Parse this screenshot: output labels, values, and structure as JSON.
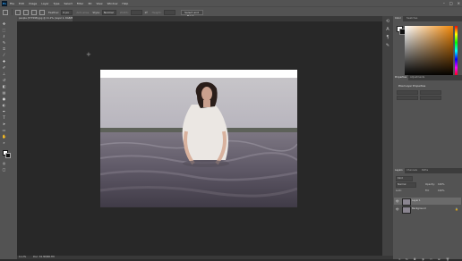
{
  "app": {
    "logo": "Ps"
  },
  "menu": [
    "File",
    "Edit",
    "Image",
    "Layer",
    "Type",
    "Select",
    "Filter",
    "3D",
    "View",
    "Window",
    "Help"
  ],
  "window_controls": [
    "–",
    "□",
    "×"
  ],
  "options": {
    "feather_label": "Feather:",
    "feather_value": "0 px",
    "anti_alias": "Anti-alias",
    "style_label": "Style:",
    "style_value": "Normal",
    "width_label": "Width:",
    "height_label": "Height:",
    "select_mask_button": "Select and Mask..."
  },
  "document": {
    "tab_title": "people (577098).jpg @ 11.2% (Layer 1, RGB/8#) *",
    "zoom": "11.2%",
    "size_info": "Doc: 34.3M/68.7M"
  },
  "panels": {
    "color_tabs": [
      "Color",
      "Swatches"
    ],
    "properties_tabs": [
      "Properties",
      "Adjustments"
    ],
    "properties_title": "Pixel Layer Properties",
    "layers_tabs": [
      "Layers",
      "Channels",
      "Paths"
    ],
    "kind_label": "Kind",
    "blend_mode": "Normal",
    "opacity_label": "Opacity:",
    "opacity_value": "100%",
    "lock_label": "Lock:",
    "fill_label": "Fill:",
    "fill_value": "100%"
  },
  "layers": [
    {
      "name": "Layer 1",
      "selected": true
    },
    {
      "name": "Background",
      "selected": false
    }
  ],
  "colors": {
    "foreground": "#ffffff",
    "background": "#111111",
    "selected_hue": "#f0880a"
  },
  "icons": {
    "tools": [
      "move-icon",
      "marquee-icon",
      "lasso-icon",
      "quick-select-icon",
      "crop-icon",
      "eyedropper-icon",
      "healing-icon",
      "brush-icon",
      "stamp-icon",
      "history-brush-icon",
      "eraser-icon",
      "gradient-icon",
      "blur-icon",
      "dodge-icon",
      "pen-icon",
      "type-icon",
      "path-select-icon",
      "rectangle-icon",
      "hand-icon",
      "zoom-icon"
    ]
  }
}
